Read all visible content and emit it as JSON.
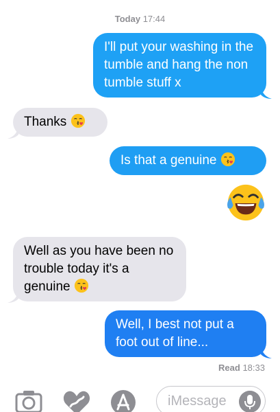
{
  "timestamp": {
    "day": "Today",
    "time": "17:44"
  },
  "messages": [
    {
      "direction": "outgoing",
      "text": "I'll put your washing in the tumble and hang the non tumble stuff x"
    },
    {
      "direction": "incoming",
      "text": "Thanks",
      "emoji": "kissing-face-with-heart"
    },
    {
      "direction": "outgoing",
      "text": "Is that a genuine",
      "emoji": "kissing-face-with-heart"
    },
    {
      "direction": "outgoing",
      "emoji_only": "face-with-tears-of-joy"
    },
    {
      "direction": "incoming",
      "text": "Well as you have been no trouble today it's a genuine",
      "emoji": "kissing-face-with-heart"
    },
    {
      "direction": "outgoing",
      "text": "Well, I best not put a foot out of line..."
    }
  ],
  "read_receipt": {
    "label": "Read",
    "time": "18:33"
  },
  "toolbar": {
    "icons": [
      "camera-icon",
      "heart-digital-touch-icon",
      "app-store-icon"
    ],
    "input_placeholder": "iMessage",
    "mic_icon": "microphone-icon"
  },
  "colors": {
    "outgoing_bubble": "#1e9ef3",
    "incoming_bubble": "#e6e5eb",
    "meta_text": "#8e8e93"
  }
}
